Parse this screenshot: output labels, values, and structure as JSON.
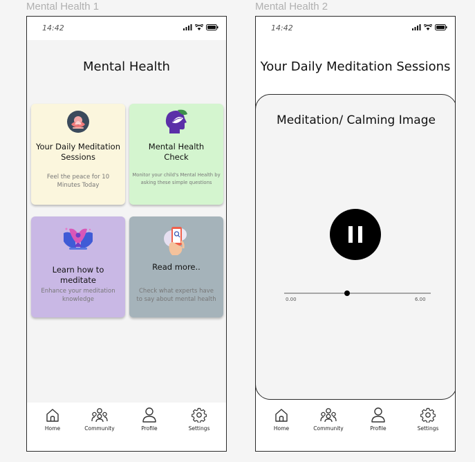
{
  "frames": [
    {
      "label": "Mental Health 1",
      "status_time": "14:42",
      "title": "Mental Health",
      "cards": [
        {
          "title": "Your Daily Meditation Sessions",
          "description": "Feel the peace for 10 Minutes Today",
          "bg": "#fbf6dd",
          "icon": "lotus-icon"
        },
        {
          "title": "Mental Health Check",
          "description": "Monitor your child's Mental Health by asking these simple questions",
          "bg": "#d4f5cf",
          "icon": "head-leaf-icon"
        },
        {
          "title": "Learn how to meditate",
          "description": "Enhance your meditation knowledge",
          "bg": "#c9b8e5",
          "icon": "meditating-figure-icon"
        },
        {
          "title": "Read more..",
          "description": "Check what experts have to say about mental health",
          "bg": "#a5b3ba",
          "icon": "phone-reading-icon"
        }
      ]
    },
    {
      "label": "Mental Health 2",
      "status_time": "14:42",
      "title": "Your Daily Meditation Sessions",
      "player": {
        "image_title": "Meditation/ Calming Image",
        "start_time": "0.00",
        "end_time": "6.00",
        "progress": 0.43,
        "state_icon": "pause-icon"
      }
    }
  ],
  "nav": [
    {
      "label": "Home",
      "icon": "home-icon"
    },
    {
      "label": "Community",
      "icon": "community-icon"
    },
    {
      "label": "Profile",
      "icon": "profile-icon"
    },
    {
      "label": "Settings",
      "icon": "settings-icon"
    }
  ],
  "colors": {
    "frame_bg": "#f4f4f4",
    "border": "#2a2a2a",
    "accent_purple": "#6a3fbf"
  }
}
